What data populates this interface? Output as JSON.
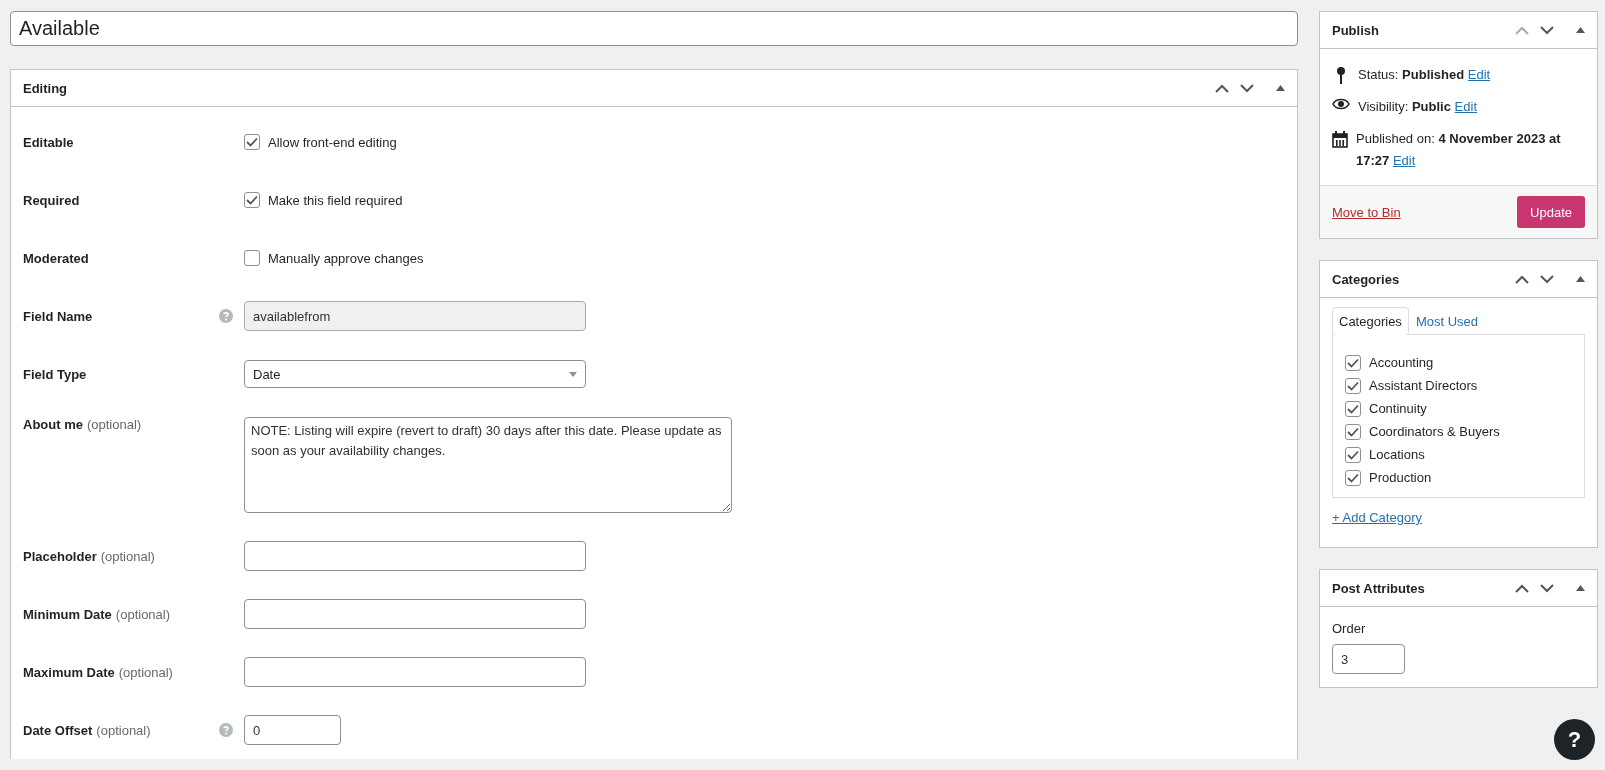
{
  "title_field": {
    "value": "Available"
  },
  "editing": {
    "title": "Editing",
    "up_disabled": false,
    "rows": [
      {
        "kind": "checkbox",
        "label": "Editable",
        "option": "Allow front-end editing",
        "checked": true
      },
      {
        "kind": "checkbox",
        "label": "Required",
        "option": "Make this field required",
        "checked": true
      },
      {
        "kind": "checkbox",
        "label": "Moderated",
        "option": "Manually approve changes",
        "checked": false
      },
      {
        "kind": "input",
        "label": "Field Name",
        "help": true,
        "value": "availablefrom",
        "disabled": true
      },
      {
        "kind": "select",
        "label": "Field Type",
        "value": "Date"
      },
      {
        "kind": "textarea",
        "label": "About me",
        "optional": "(optional)",
        "value": "NOTE: Listing will expire (revert to draft) 30 days after this date. Please update as soon as your availability changes."
      },
      {
        "kind": "input",
        "label": "Placeholder",
        "optional": "(optional)",
        "disabled": false
      },
      {
        "kind": "input",
        "label": "Minimum Date",
        "optional": "(optional)",
        "disabled": false
      },
      {
        "kind": "input",
        "label": "Maximum Date",
        "optional": "(optional)",
        "disabled": false
      },
      {
        "kind": "number",
        "label": "Date Offset",
        "optional": "(optional)",
        "help": true,
        "value": "0"
      }
    ]
  },
  "publish": {
    "title": "Publish",
    "up_disabled": true,
    "items": [
      {
        "kind": "status",
        "text": "Status: **Published**",
        "link": "Edit"
      },
      {
        "kind": "visibility",
        "text": "Visibility: **Public**",
        "link": "Edit"
      },
      {
        "kind": "date",
        "text": "Published on: **4 November 2023 at 17:27**",
        "link": "Edit"
      }
    ],
    "trash_link": "Move to Bin",
    "update_button": "Update"
  },
  "categories": {
    "title": "Categories",
    "up_disabled": false,
    "tabs": [
      {
        "label": "Categories",
        "selected": true
      },
      {
        "label": "Most Used",
        "selected": false
      }
    ],
    "items": [
      {
        "label": "Accounting",
        "checked": true
      },
      {
        "label": "Assistant Directors",
        "checked": true
      },
      {
        "label": "Continuity",
        "checked": true
      },
      {
        "label": "Coordinators & Buyers",
        "checked": true
      },
      {
        "label": "Locations",
        "checked": true
      },
      {
        "label": "Production",
        "checked": true
      }
    ],
    "add_link": "+ Add Category"
  },
  "post_attributes": {
    "title": "Post Attributes",
    "up_disabled": false,
    "order_label": "Order",
    "order_value": "3"
  },
  "help_button": {
    "label": "?"
  }
}
